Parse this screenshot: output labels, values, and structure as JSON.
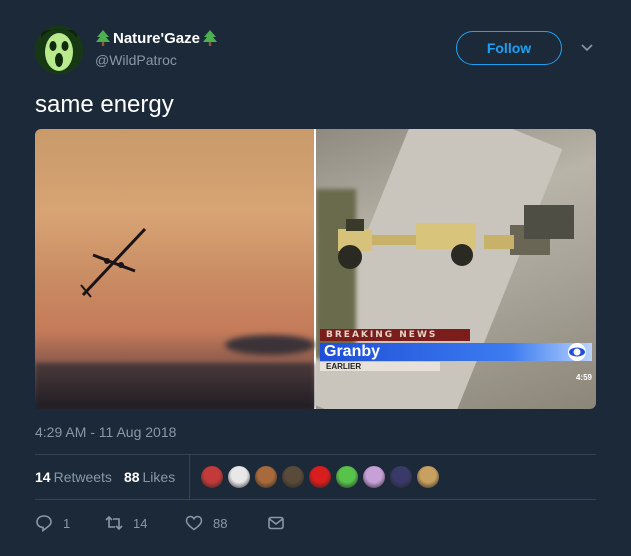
{
  "author": {
    "display_name": "Nature'Gaze",
    "handle": "@WildPatroc",
    "avatar_icon": "scream-mask-avatar",
    "name_decoration_icon": "evergreen-tree-icon"
  },
  "header": {
    "follow_label": "Follow",
    "menu_icon": "chevron-down-icon"
  },
  "tweet": {
    "text": "same energy"
  },
  "media": {
    "left_image": "plane-in-sunset-sky",
    "right_image": "bulldozer-news-footage",
    "news_banner": "BREAKING NEWS",
    "news_location": "Granby",
    "news_tag": "EARLIER",
    "news_time": "4:59",
    "network_logo_icon": "cbs-eye-icon"
  },
  "timestamp": "4:29 AM - 11 Aug 2018",
  "stats": {
    "retweets_count": "14",
    "retweets_label": "Retweets",
    "likes_count": "88",
    "likes_label": "Likes",
    "liker_avatar_colors": [
      "#c23a3a",
      "#e8e8e8",
      "#a86a3c",
      "#5a4a3a",
      "#d81e1e",
      "#58c24a",
      "#c8a0d8",
      "#3a3a6a",
      "#c8a060"
    ]
  },
  "actions": {
    "reply_count": "1",
    "retweet_count": "14",
    "like_count": "88"
  },
  "colors": {
    "background": "#1c2938",
    "accent": "#1da1f2",
    "muted_text": "#8899a6",
    "divider": "#38444d"
  }
}
